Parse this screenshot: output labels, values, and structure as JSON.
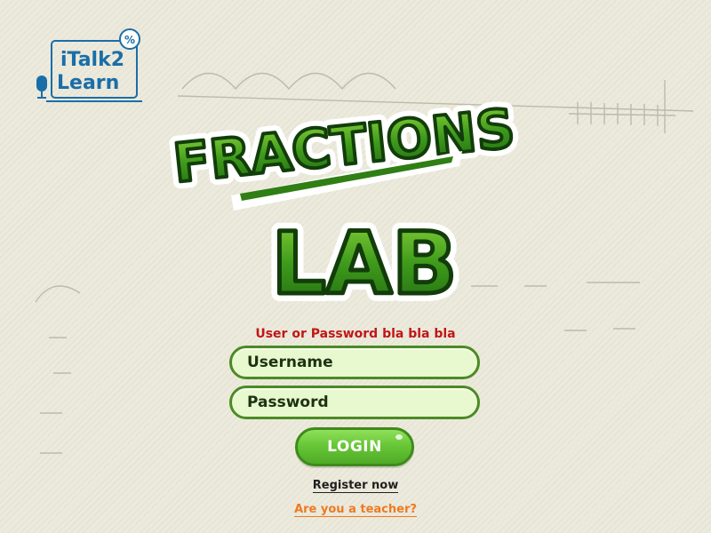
{
  "logo": {
    "line1": "iTalk2",
    "line2": "Learn",
    "percent_symbol": "%"
  },
  "title": {
    "word1": "FRACTIONS",
    "word2": "LAB"
  },
  "login_form": {
    "error_message": "User or Password bla bla bla",
    "username_placeholder": "Username",
    "password_placeholder": "Password",
    "login_label": "LOGIN",
    "register_link": "Register now",
    "teacher_link": "Are you a teacher?"
  },
  "colors": {
    "brand_green": "#4b8a23",
    "field_fill": "#e8f9cf",
    "error_red": "#c01717",
    "teacher_orange": "#ee7a22",
    "logo_blue": "#1a6ea8"
  },
  "icons": [
    "microphone-icon",
    "laptop-icon",
    "speech-bubble-icon"
  ]
}
